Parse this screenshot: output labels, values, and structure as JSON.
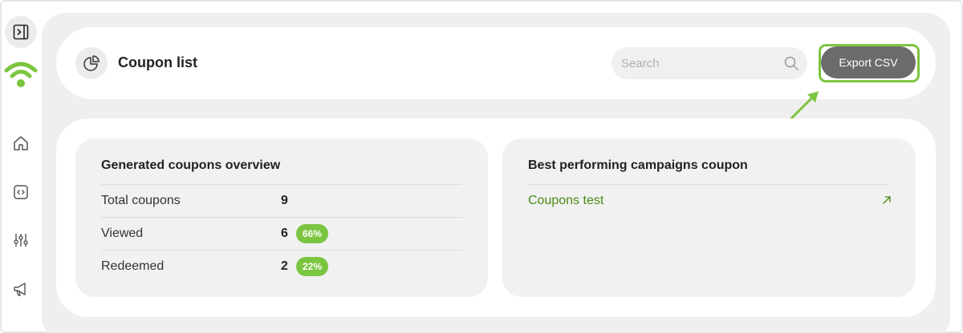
{
  "header": {
    "title": "Coupon list",
    "search_placeholder": "Search",
    "export_label": "Export CSV"
  },
  "colors": {
    "accent": "#7cc540",
    "link": "#4a8a14",
    "button": "#6b6b6b"
  },
  "sidebar": {
    "items": [
      {
        "icon": "sidebar-toggle-icon"
      },
      {
        "icon": "wifi-logo-icon"
      },
      {
        "icon": "home-icon"
      },
      {
        "icon": "code-icon"
      },
      {
        "icon": "sliders-icon"
      },
      {
        "icon": "megaphone-icon"
      }
    ]
  },
  "overview": {
    "title": "Generated coupons overview",
    "rows": [
      {
        "label": "Total coupons",
        "value": "9",
        "badge": ""
      },
      {
        "label": "Viewed",
        "value": "6",
        "badge": "66%"
      },
      {
        "label": "Redeemed",
        "value": "2",
        "badge": "22%"
      }
    ]
  },
  "campaigns": {
    "title": "Best performing campaigns coupon",
    "items": [
      {
        "label": "Coupons test"
      }
    ]
  }
}
